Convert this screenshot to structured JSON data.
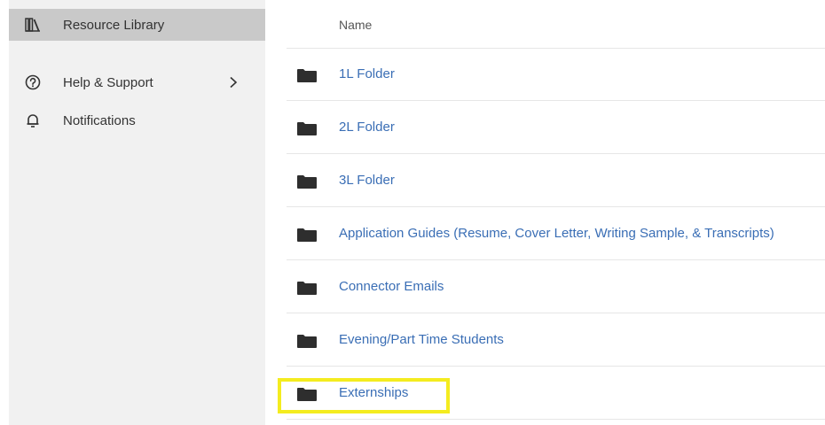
{
  "sidebar": {
    "items": [
      {
        "label": "Resource Library",
        "icon": "books-icon",
        "active": true
      },
      {
        "label": "Help & Support",
        "icon": "question-circle-icon",
        "has_submenu": true
      },
      {
        "label": "Notifications",
        "icon": "bell-icon"
      }
    ]
  },
  "table": {
    "header": {
      "name": "Name"
    },
    "rows": [
      {
        "name": "1L Folder",
        "icon": "folder-icon"
      },
      {
        "name": "2L Folder",
        "icon": "folder-icon"
      },
      {
        "name": "3L Folder",
        "icon": "folder-icon"
      },
      {
        "name": "Application Guides (Resume, Cover Letter, Writing Sample, & Transcripts)",
        "icon": "folder-icon"
      },
      {
        "name": "Connector Emails",
        "icon": "folder-icon"
      },
      {
        "name": "Evening/Part Time Students",
        "icon": "folder-icon"
      },
      {
        "name": "Externships",
        "icon": "folder-icon",
        "highlighted": true
      }
    ]
  },
  "colors": {
    "link": "#3a6eb5",
    "highlight": "#f4ec1f",
    "sidebar_bg": "#f1f1f1",
    "active_item_bg": "#c9c9c9"
  }
}
